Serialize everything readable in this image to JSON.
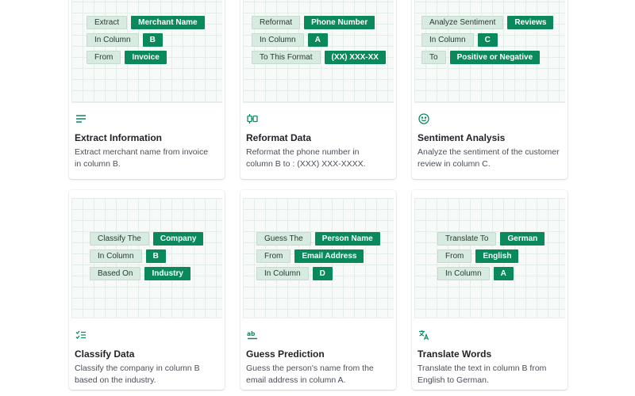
{
  "cards": [
    {
      "title": "Extract Information",
      "description": "Extract merchant name from invoice in column B.",
      "icon": "lines-icon",
      "rows": [
        {
          "label": "Extract",
          "value": "Merchant Name"
        },
        {
          "label": "In Column",
          "value": "B"
        },
        {
          "label": "From",
          "value": "Invoice"
        }
      ]
    },
    {
      "title": "Reformat Data",
      "description": "Reformat the phone number in column B to : (XXX) XXX-XXXX.",
      "icon": "reformat-icon",
      "rows": [
        {
          "label": "Reformat",
          "value": "Phone Number"
        },
        {
          "label": "In Column",
          "value": "A"
        },
        {
          "label": "To This Format",
          "value": "(XX) XXX-XX"
        }
      ]
    },
    {
      "title": "Sentiment Analysis",
      "description": "Analyze the sentiment of the customer review in column C.",
      "icon": "smiley-icon",
      "rows": [
        {
          "label": "Analyze Sentiment",
          "value": "Reviews"
        },
        {
          "label": "In Column",
          "value": "C"
        },
        {
          "label": "To",
          "value": "Positive or Negative"
        }
      ]
    },
    {
      "title": "Classify Data",
      "description": "Classify the company in column B based on the industry.",
      "icon": "checklist-icon",
      "rows": [
        {
          "label": "Classify The",
          "value": "Company"
        },
        {
          "label": "In Column",
          "value": "B"
        },
        {
          "label": "Based On",
          "value": "Industry"
        }
      ]
    },
    {
      "title": "Guess Prediction",
      "description": "Guess the person's name from the email address in column A.",
      "icon": "spellcheck-icon",
      "rows": [
        {
          "label": "Guess The",
          "value": "Person Name"
        },
        {
          "label": "From",
          "value": "Email Address"
        },
        {
          "label": "In Column",
          "value": "D"
        }
      ]
    },
    {
      "title": "Translate Words",
      "description": "Translate the text in column B from English to German.",
      "icon": "translate-icon",
      "rows": [
        {
          "label": "Translate To",
          "value": "German"
        },
        {
          "label": "From",
          "value": "English"
        },
        {
          "label": "In Column",
          "value": "A"
        }
      ]
    }
  ],
  "colors": {
    "accent": "#0a8a5c",
    "chip_label_bg": "#d7ebe0",
    "grid_bg": "#f7faf8"
  }
}
